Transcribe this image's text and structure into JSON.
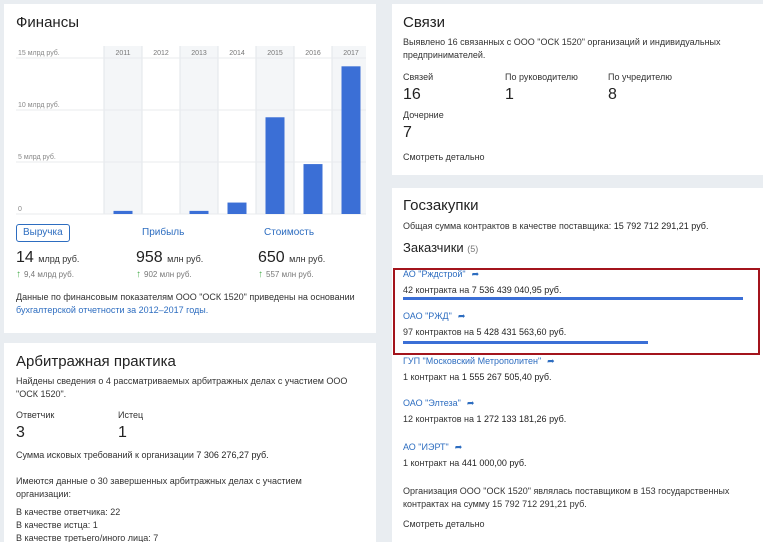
{
  "finance": {
    "title": "Финансы",
    "chart_data": {
      "type": "bar",
      "categories": [
        "2011",
        "2012",
        "2013",
        "2014",
        "2015",
        "2016",
        "2017"
      ],
      "values": [
        0.3,
        0,
        0.3,
        1.1,
        9.3,
        4.8,
        14.2
      ],
      "y_ticks": [
        "0",
        "5 млрд руб.",
        "10 млрд руб.",
        "15 млрд руб."
      ],
      "ylim": [
        0,
        15
      ],
      "bar_color": "#3b6fd6"
    },
    "tabs": [
      "Выручка",
      "Прибыль",
      "Стоимость"
    ],
    "kpis": [
      {
        "value": "14",
        "unit": "млрд руб.",
        "delta": "9,4 млрд руб."
      },
      {
        "value": "958",
        "unit": "млн руб.",
        "delta": "902 млн руб."
      },
      {
        "value": "650",
        "unit": "млн руб.",
        "delta": "557 млн руб."
      }
    ],
    "note_text": "Данные по финансовым показателям ООО \"ОСК 1520\" приведены на основании",
    "note_link": "бухгалтерской отчетности за 2012–2017 годы."
  },
  "arbitration": {
    "title": "Арбитражная практика",
    "found": "Найдены сведения о 4 рассматриваемых арбитражных делах с участием ООО \"ОСК 1520\".",
    "defendant_label": "Ответчик",
    "defendant_value": "3",
    "plaintiff_label": "Истец",
    "plaintiff_value": "1",
    "claims_text": "Сумма исковых требований к организации",
    "claims_value": "7 306 276,27 руб.",
    "completed_text": "Имеются данные о 30 завершенных арбитражных делах с участием организации:",
    "roles": [
      "В качестве ответчика: 22",
      "В качестве истца: 1",
      "В качестве третьего/иного лица: 7"
    ]
  },
  "links": {
    "title": "Связи",
    "desc": "Выявлено 16 связанных с ООО \"ОСК 1520\" организаций и индивидуальных предпринимателей.",
    "stats": [
      {
        "label": "Связей",
        "value": "16"
      },
      {
        "label": "По руководителю",
        "value": "1"
      },
      {
        "label": "По учредителю",
        "value": "8"
      },
      {
        "label": "Дочерние",
        "value": "7"
      }
    ],
    "more": "Смотреть детально"
  },
  "gos": {
    "title": "Госзакупки",
    "total_text": "Общая сумма контрактов в качестве поставщика:",
    "total_value": "15 792 712 291,21 руб.",
    "customers_title": "Заказчики",
    "customers_count": "(5)",
    "customers": [
      {
        "name": "АО \"Рждстрой\"",
        "count": "42 контракта на",
        "sum": "7 536 439 040,95 руб.",
        "share": 1.0
      },
      {
        "name": "ОАО \"РЖД\"",
        "count": "97 контрактов на",
        "sum": "5 428 431 563,60 руб.",
        "share": 0.72
      },
      {
        "name": "ГУП \"Московский Метрополитен\"",
        "count": "1 контракт на",
        "sum": "1 555 267 505,40 руб.",
        "share": 0
      },
      {
        "name": "ОАО \"Элтеза\"",
        "count": "12 контрактов на",
        "sum": "1 272 133 181,26 руб.",
        "share": 0
      },
      {
        "name": "АО \"ИЭРТ\"",
        "count": "1 контракт на",
        "sum": "441 000,00 руб.",
        "share": 0
      }
    ],
    "summary": "Организация ООО \"ОСК 1520\" являлась поставщиком в 153 государственных контрактах на сумму 15 792 712 291,21 руб.",
    "more": "Смотреть детально"
  }
}
